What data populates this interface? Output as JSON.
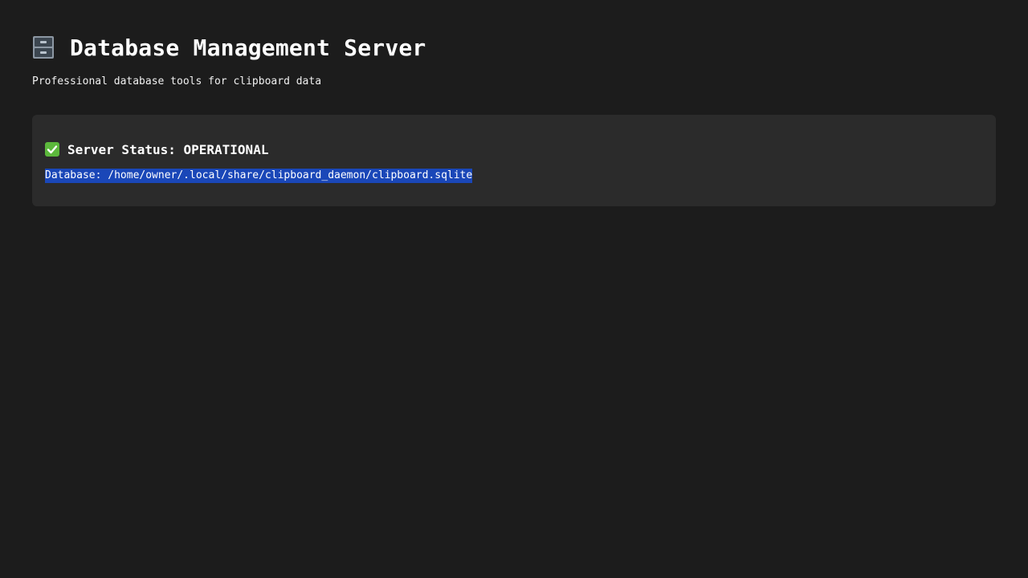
{
  "header": {
    "icon": "file-cabinet-icon",
    "title": "Database Management Server",
    "subtitle": "Professional database tools for clipboard data"
  },
  "status_card": {
    "status_icon": "check-mark-icon",
    "status_text": "Server Status: OPERATIONAL",
    "database_path": "Database: /home/owner/.local/share/clipboard_daemon/clipboard.sqlite"
  },
  "colors": {
    "background": "#1c1c1c",
    "card": "#2b2b2b",
    "selection": "#1a47b8",
    "check": "#5cb83c"
  }
}
